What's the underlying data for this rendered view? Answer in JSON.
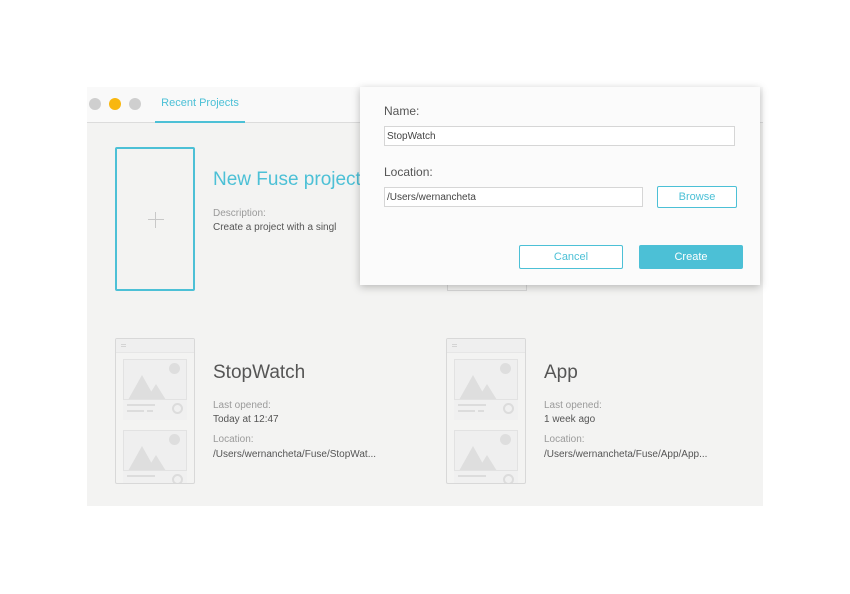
{
  "window": {
    "tabs": [
      {
        "label": "Recent Projects",
        "active": true
      }
    ]
  },
  "new_project": {
    "title": "New Fuse project",
    "description_label": "Description:",
    "description": "Create a project with a singl"
  },
  "projects": [
    {
      "name": "StopWatch",
      "last_opened_label": "Last opened:",
      "last_opened": "Today at 12:47",
      "location_label": "Location:",
      "location": "/Users/wernancheta/Fuse/StopWat..."
    },
    {
      "name": "App",
      "last_opened_label": "Last opened:",
      "last_opened": "1 week ago",
      "location_label": "Location:",
      "location": "/Users/wernancheta/Fuse/App/App..."
    }
  ],
  "dialog": {
    "name_label": "Name:",
    "name_value": "StopWatch",
    "location_label": "Location:",
    "location_value": "/Users/wernancheta",
    "browse_label": "Browse",
    "cancel_label": "Cancel",
    "create_label": "Create"
  },
  "colors": {
    "accent": "#4cc0d6",
    "minimize": "#f9b70f",
    "background": "#f3f3f2"
  }
}
